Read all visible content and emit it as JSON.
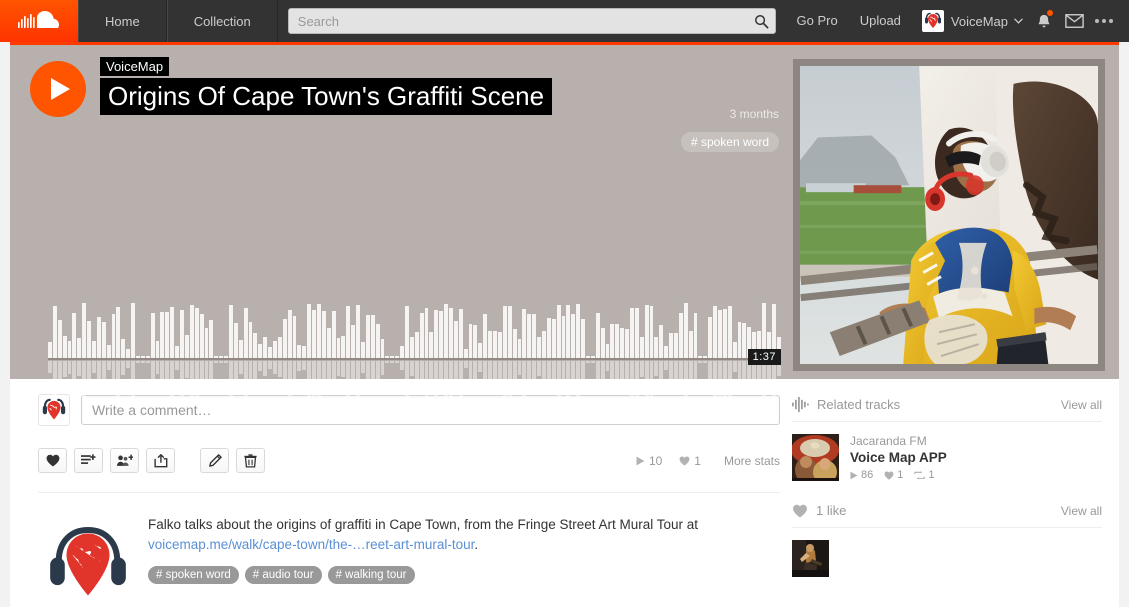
{
  "header": {
    "logo": "soundcloud-logo",
    "nav": [
      {
        "label": "Home",
        "name": "nav-home"
      },
      {
        "label": "Collection",
        "name": "nav-collection"
      }
    ],
    "search": {
      "placeholder": "Search",
      "value": "",
      "icon": "search-icon"
    },
    "go_pro": "Go Pro",
    "upload": "Upload",
    "username": "VoiceMap",
    "icons": [
      "bell-icon",
      "envelope-icon",
      "more-dots-icon"
    ],
    "has_notification": true
  },
  "hero": {
    "play_label": "Play",
    "username": "VoiceMap",
    "title": "Origins Of Cape Town's Graffiti Scene",
    "age": "3 months",
    "genre": "# spoken word",
    "duration": "1:37",
    "accent": "#ff5500",
    "background": "#b8b0ac"
  },
  "comment": {
    "placeholder": "Write a comment…",
    "value": ""
  },
  "actions": [
    {
      "name": "like-button",
      "icon": "heart-icon"
    },
    {
      "name": "add-to-playlist-button",
      "icon": "playlist-add-icon"
    },
    {
      "name": "share-to-group-button",
      "icon": "group-add-icon"
    },
    {
      "name": "share-button",
      "icon": "share-icon"
    },
    {
      "name": "edit-button",
      "icon": "pencil-icon"
    },
    {
      "name": "delete-button",
      "icon": "trash-icon"
    }
  ],
  "stats": {
    "plays": "10",
    "likes": "1",
    "more_stats": "More stats"
  },
  "description": {
    "text_before": "Falko talks about the origins of graffiti in Cape Town, from the Fringe Street Art Mural Tour at ",
    "link": "voicemap.me/walk/cape-town/the-…reet-art-mural-tour",
    "text_after": ".",
    "tags": [
      "# spoken word",
      "# audio tour",
      "# walking tour"
    ],
    "logo": "voicemap-logo"
  },
  "sidebar": {
    "related": {
      "title": "Related tracks",
      "icon": "waveform-icon",
      "view_all": "View all",
      "tracks": [
        {
          "user": "Jacaranda FM",
          "title": "Voice Map APP",
          "plays": "86",
          "likes": "1",
          "reposts": "1"
        }
      ]
    },
    "likes": {
      "title": "1 like",
      "icon": "heart-icon",
      "view_all": "View all",
      "likers": [
        "liker-avatar"
      ]
    }
  }
}
